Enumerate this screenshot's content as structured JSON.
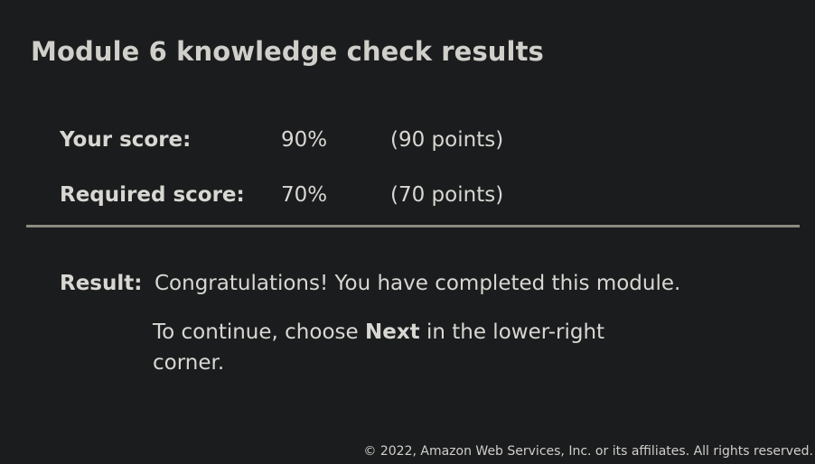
{
  "title": "Module 6 knowledge check results",
  "scores": {
    "your": {
      "label": "Your score:",
      "percent": "90%",
      "points": "(90 points)"
    },
    "required": {
      "label": "Required score:",
      "percent": "70%",
      "points": "(70 points)"
    }
  },
  "result": {
    "label": "Result:",
    "message": "Congratulations! You have completed this module.",
    "continue_before": "To continue, choose ",
    "continue_emphasis": "Next",
    "continue_after": " in the lower-right corner."
  },
  "footer": "© 2022, Amazon Web Services, Inc. or its affiliates. All rights reserved."
}
